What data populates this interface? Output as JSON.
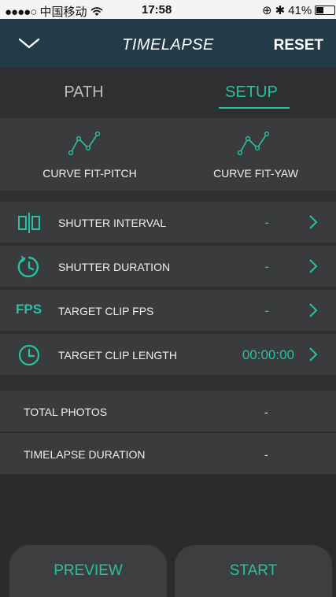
{
  "status_bar": {
    "signal": "●●●●○",
    "carrier": "中国移动",
    "wifi": "wifi-icon",
    "time": "17:58",
    "lock": "⊕",
    "bluetooth": "✱",
    "battery": "41%"
  },
  "nav": {
    "back_icon": "chevron-down-icon",
    "title": "TIMELAPSE",
    "reset_label": "RESET"
  },
  "tabs": {
    "path": "PATH",
    "setup": "SETUP",
    "active": "SETUP"
  },
  "curves": {
    "pitch_label": "CURVE FIT-PITCH",
    "yaw_label": "CURVE FIT-YAW"
  },
  "settings": [
    {
      "icon": "shutter-interval-icon",
      "label": "SHUTTER INTERVAL",
      "value": "-"
    },
    {
      "icon": "stopwatch-icon",
      "label": "SHUTTER DURATION",
      "value": "-"
    },
    {
      "icon": "fps-icon",
      "icon_text": "FPS",
      "label": "TARGET CLIP FPS",
      "value": "-"
    },
    {
      "icon": "clock-icon",
      "label": "TARGET CLIP LENGTH",
      "value": "00:00:00"
    }
  ],
  "summary": [
    {
      "label": "TOTAL PHOTOS",
      "value": "-"
    },
    {
      "label": "TIMELAPSE DURATION",
      "value": "-"
    }
  ],
  "buttons": {
    "preview": "PREVIEW",
    "start": "START"
  },
  "colors": {
    "accent": "#27c1a3",
    "nav_bg": "#233a48",
    "row_bg": "#3a3b3d",
    "page_bg": "#2b2c2e"
  }
}
